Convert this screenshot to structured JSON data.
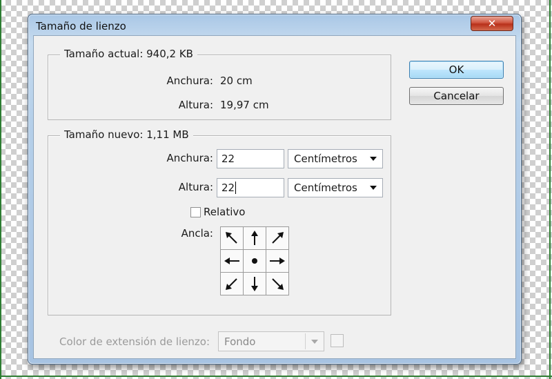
{
  "dialog": {
    "title": "Tamaño de lienzo",
    "close_glyph": "✕"
  },
  "current_size": {
    "legend": "Tamaño actual: 940,2 KB",
    "width_label": "Anchura:",
    "width_value": "20 cm",
    "height_label": "Altura:",
    "height_value": "19,97 cm"
  },
  "new_size": {
    "legend": "Tamaño nuevo: 1,11 MB",
    "width_label": "Anchura:",
    "width_value": "22",
    "width_unit": "Centímetros",
    "height_label": "Altura:",
    "height_value": "22",
    "height_unit": "Centímetros",
    "relative_label": "Relativo",
    "relative_checked": false,
    "anchor_label": "Ancla:",
    "anchor_cells": [
      "arrow-up-left-icon",
      "arrow-up-icon",
      "arrow-up-right-icon",
      "arrow-left-icon",
      "anchor-center-dot-icon",
      "arrow-right-icon",
      "arrow-down-left-icon",
      "arrow-down-icon",
      "arrow-down-right-icon"
    ]
  },
  "extension": {
    "label": "Color de extensión de lienzo:",
    "value": "Fondo"
  },
  "buttons": {
    "ok": "OK",
    "cancel": "Cancelar"
  }
}
